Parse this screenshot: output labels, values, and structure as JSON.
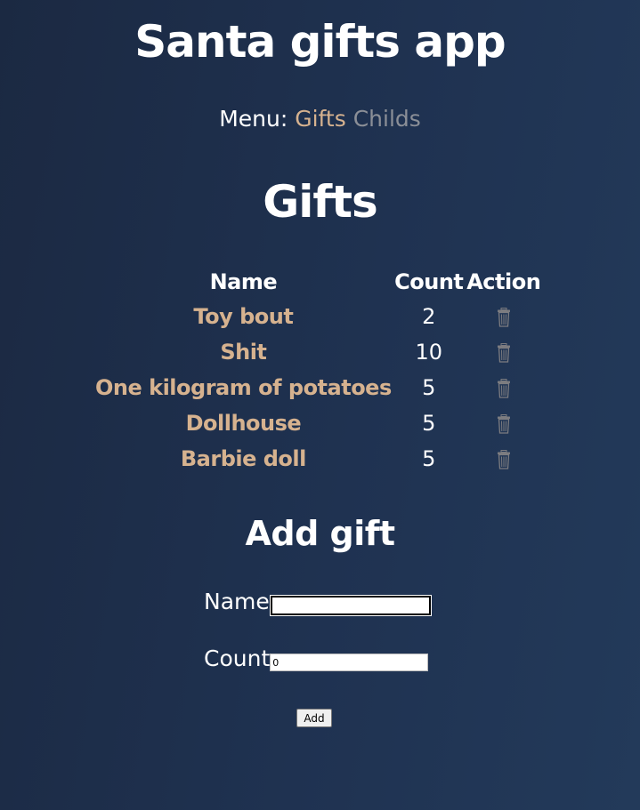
{
  "app": {
    "title": "Santa gifts app"
  },
  "menu": {
    "label": "Menu:",
    "items": [
      {
        "label": "Gifts",
        "color": "#d6b28f"
      },
      {
        "label": "Childs",
        "color": "#8b8f97"
      }
    ]
  },
  "gifts": {
    "title": "Gifts",
    "columns": [
      "Name",
      "Count",
      "Action"
    ],
    "rows": [
      {
        "name": "Toy bout",
        "count": "2",
        "action_icon": "trash-icon"
      },
      {
        "name": "Shit",
        "count": "10",
        "action_icon": "trash-icon"
      },
      {
        "name": "One kilogram of potatoes",
        "count": "5",
        "action_icon": "trash-icon"
      },
      {
        "name": "Dollhouse",
        "count": "5",
        "action_icon": "trash-icon"
      },
      {
        "name": "Barbie doll",
        "count": "5",
        "action_icon": "trash-icon"
      }
    ]
  },
  "add_gift": {
    "title": "Add gift",
    "name_label": "Name",
    "name_value": "",
    "count_label": "Count",
    "count_value": "0",
    "button_label": "Add"
  },
  "colors": {
    "accent": "#d6b28f",
    "muted": "#8b8f97",
    "background": "#1f3251"
  }
}
